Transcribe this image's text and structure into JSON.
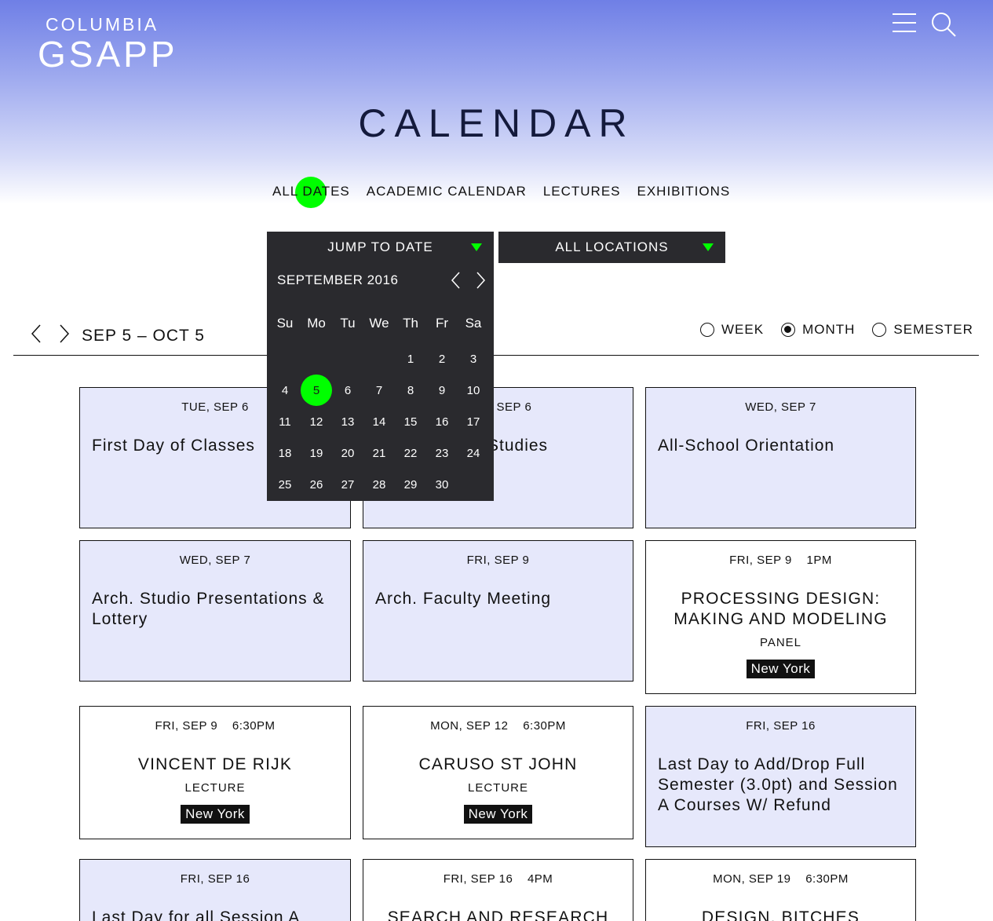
{
  "logo": {
    "line1": "COLUMBIA",
    "line2": "GSAPP"
  },
  "header": {
    "menu_icon": "hamburger-menu-icon",
    "search_icon": "search-icon"
  },
  "title": "CALENDAR",
  "tabs": [
    "ALL DATES",
    "ACADEMIC CALENDAR",
    "LECTURES",
    "EXHIBITIONS"
  ],
  "accent": "#00ff00",
  "filters": {
    "jump": "JUMP TO DATE",
    "locations": "ALL LOCATIONS"
  },
  "datepicker": {
    "month": "SEPTEMBER 2016",
    "weekdays": [
      "Su",
      "Mo",
      "Tu",
      "We",
      "Th",
      "Fr",
      "Sa"
    ],
    "weeks": [
      [
        "",
        "",
        "",
        "",
        "1",
        "2",
        "3"
      ],
      [
        "4",
        "5",
        "6",
        "7",
        "8",
        "9",
        "10"
      ],
      [
        "11",
        "12",
        "13",
        "14",
        "15",
        "16",
        "17"
      ],
      [
        "18",
        "19",
        "20",
        "21",
        "22",
        "23",
        "24"
      ],
      [
        "25",
        "26",
        "27",
        "28",
        "29",
        "30",
        ""
      ]
    ],
    "selected": "5"
  },
  "range": {
    "label": "SEP 5 – OCT 5"
  },
  "view_options": {
    "week": "WEEK",
    "month": "MONTH",
    "semester": "SEMESTER",
    "selected": "MONTH"
  },
  "events": [
    {
      "date": "TUE, SEP 6",
      "title": "First Day of Classes"
    },
    {
      "date": "TUE, SEP 6",
      "title": "Studies"
    },
    {
      "date": "WED, SEP 7",
      "title": "All-School Orientation"
    },
    {
      "date": "WED, SEP 7",
      "title": "Arch. Studio Presentations & Lottery"
    },
    {
      "date": "FRI, SEP 9",
      "title": "Arch. Faculty Meeting"
    },
    {
      "date": "FRI, SEP 9    1PM",
      "title": "PROCESSING DESIGN: MAKING AND MODELING",
      "kind": "PANEL",
      "location": "New York"
    },
    {
      "date": "FRI, SEP 9    6:30PM",
      "title": "VINCENT DE RIJK",
      "kind": "LECTURE",
      "location": "New York"
    },
    {
      "date": "MON, SEP 12    6:30PM",
      "title": "CARUSO ST JOHN",
      "kind": "LECTURE",
      "location": "New York"
    },
    {
      "date": "FRI, SEP 16",
      "title": "Last Day to Add/Drop Full Semester (3.0pt) and Session A Courses W/ Refund"
    },
    {
      "date": "FRI, SEP 16",
      "title": "Last Day for all Session A"
    },
    {
      "date": "FRI, SEP 16    4PM",
      "title": "SEARCH AND RESEARCH"
    },
    {
      "date": "MON, SEP 19    6:30PM",
      "title": "DESIGN, BITCHES"
    }
  ]
}
